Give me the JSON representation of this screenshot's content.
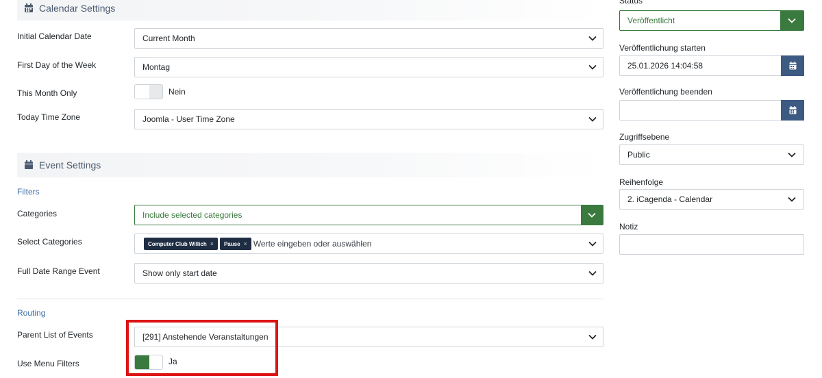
{
  "calendar_settings": {
    "title": "Calendar Settings",
    "initial_date": {
      "label": "Initial Calendar Date",
      "value": "Current Month"
    },
    "first_day": {
      "label": "First Day of the Week",
      "value": "Montag"
    },
    "this_month_only": {
      "label": "This Month Only",
      "value": "Nein",
      "on": false
    },
    "time_zone": {
      "label": "Today Time Zone",
      "value": "Joomla - User Time Zone"
    }
  },
  "event_settings": {
    "title": "Event Settings",
    "filters_heading": "Filters",
    "categories": {
      "label": "Categories",
      "value": "Include selected categories"
    },
    "select_categories": {
      "label": "Select Categories",
      "tags": [
        "Computer Club Willich",
        "Pause"
      ],
      "placeholder": "Werte eingeben oder auswählen"
    },
    "full_date_range": {
      "label": "Full Date Range Event",
      "value": "Show only start date"
    },
    "routing_heading": "Routing",
    "parent_list": {
      "label": "Parent List of Events",
      "value": "[291] Anstehende Veranstaltungen"
    },
    "use_menu_filters": {
      "label": "Use Menu Filters",
      "value": "Ja",
      "on": true
    }
  },
  "sidebar": {
    "status": {
      "label": "Status",
      "value": "Veröffentlicht"
    },
    "publish_up": {
      "label": "Veröffentlichung starten",
      "value": "25.01.2026 14:04:58"
    },
    "publish_down": {
      "label": "Veröffentlichung beenden",
      "value": ""
    },
    "access": {
      "label": "Zugriffsebene",
      "value": "Public"
    },
    "ordering": {
      "label": "Reihenfolge",
      "value": "2. iCagenda - Calendar"
    },
    "note": {
      "label": "Notiz",
      "value": ""
    }
  },
  "colors": {
    "accent_green": "#3a7a3e",
    "calendar_button": "#3c5a82",
    "highlight": "#dd1414",
    "link_blue": "#3d6ea5"
  },
  "icons": [
    "calendar-icon",
    "chevron-down-icon",
    "tag-remove-icon"
  ]
}
